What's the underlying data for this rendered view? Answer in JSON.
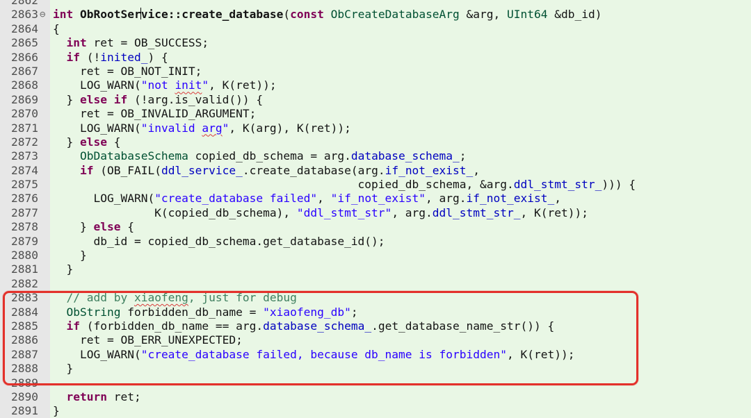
{
  "editor": {
    "colors": {
      "background": "#e9f7e5",
      "gutter": "#e7e7e7",
      "keyword": "#7f0055",
      "string": "#2a00ff",
      "member": "#0000c0",
      "type": "#005032",
      "comment": "#3f7f5f",
      "highlight_box": "#e3312b"
    },
    "fold_icon": "collapse-minus-icon",
    "lines": [
      {
        "num": "2862",
        "t": ""
      },
      {
        "num": "2863",
        "t": "int ObRootService::create_database(const ObCreateDatabaseArg &arg, UInt64 &db_id)"
      },
      {
        "num": "2864",
        "t": "{"
      },
      {
        "num": "2865",
        "t": "  int ret = OB_SUCCESS;"
      },
      {
        "num": "2866",
        "t": "  if (!inited_) {"
      },
      {
        "num": "2867",
        "t": "    ret = OB_NOT_INIT;"
      },
      {
        "num": "2868",
        "t": "    LOG_WARN(\"not init\", K(ret));"
      },
      {
        "num": "2869",
        "t": "  } else if (!arg.is_valid()) {"
      },
      {
        "num": "2870",
        "t": "    ret = OB_INVALID_ARGUMENT;"
      },
      {
        "num": "2871",
        "t": "    LOG_WARN(\"invalid arg\", K(arg), K(ret));"
      },
      {
        "num": "2872",
        "t": "  } else {"
      },
      {
        "num": "2873",
        "t": "    ObDatabaseSchema copied_db_schema = arg.database_schema_;"
      },
      {
        "num": "2874",
        "t": "    if (OB_FAIL(ddl_service_.create_database(arg.if_not_exist_,"
      },
      {
        "num": "2875",
        "t": "                                             copied_db_schema, &arg.ddl_stmt_str_))) {"
      },
      {
        "num": "2876",
        "t": "      LOG_WARN(\"create_database failed\", \"if_not_exist\", arg.if_not_exist_,"
      },
      {
        "num": "2877",
        "t": "               K(copied_db_schema), \"ddl_stmt_str\", arg.ddl_stmt_str_, K(ret));"
      },
      {
        "num": "2878",
        "t": "    } else {"
      },
      {
        "num": "2879",
        "t": "      db_id = copied_db_schema.get_database_id();"
      },
      {
        "num": "2880",
        "t": "    }"
      },
      {
        "num": "2881",
        "t": "  }"
      },
      {
        "num": "2882",
        "t": ""
      },
      {
        "num": "2883",
        "t": "  // add by xiaofeng, just for debug"
      },
      {
        "num": "2884",
        "t": "  ObString forbidden_db_name = \"xiaofeng_db\";"
      },
      {
        "num": "2885",
        "t": "  if (forbidden_db_name == arg.database_schema_.get_database_name_str()) {"
      },
      {
        "num": "2886",
        "t": "    ret = OB_ERR_UNEXPECTED;"
      },
      {
        "num": "2887",
        "t": "    LOG_WARN(\"create_database failed, because db_name is forbidden\", K(ret));"
      },
      {
        "num": "2888",
        "t": "  }"
      },
      {
        "num": "2889",
        "t": ""
      },
      {
        "num": "2890",
        "t": "  return ret;"
      },
      {
        "num": "2891",
        "t": "}"
      }
    ]
  }
}
